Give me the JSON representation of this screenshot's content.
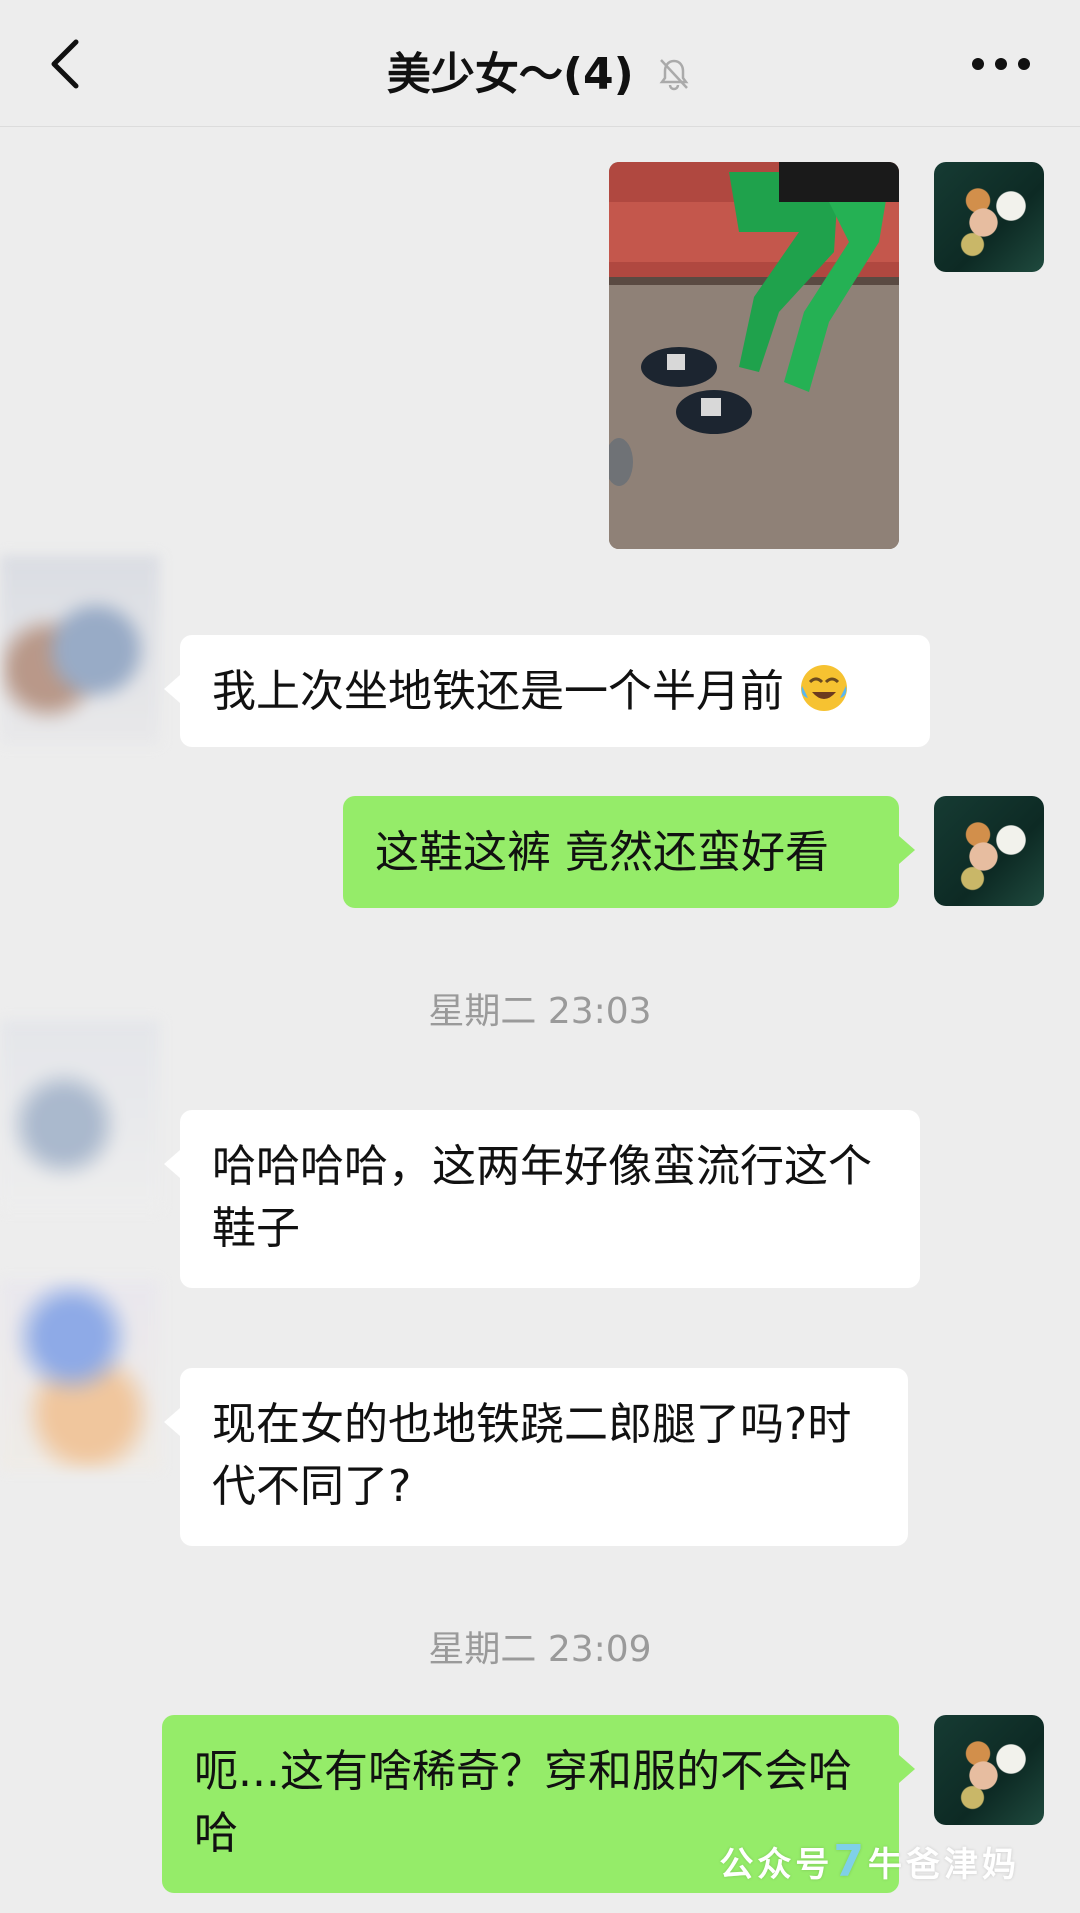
{
  "header": {
    "title": "美少女～(4)",
    "muted": true
  },
  "messages": [
    {
      "type": "image",
      "sender": "me",
      "alt": ""
    },
    {
      "type": "text",
      "sender": "other",
      "text": "我上次坐地铁还是一个半月前",
      "emoji": "face-with-tears"
    },
    {
      "type": "text",
      "sender": "me",
      "text": "这鞋这裤 竟然还蛮好看"
    },
    {
      "type": "time",
      "text": "星期二 23:03"
    },
    {
      "type": "text",
      "sender": "other",
      "text": "哈哈哈哈，这两年好像蛮流行这个鞋子"
    },
    {
      "type": "text",
      "sender": "other",
      "text": "现在女的也地铁跷二郎腿了吗?时代不同了?"
    },
    {
      "type": "time",
      "text": "星期二 23:09"
    },
    {
      "type": "text",
      "sender": "me",
      "text": "呃...这有啥稀奇？穿和服的不会哈哈"
    }
  ],
  "watermark": {
    "prefix": "公众号",
    "seven": "7",
    "suffix": "牛爸津妈"
  },
  "colors": {
    "background": "#ededed",
    "my_bubble": "#95ec69",
    "their_bubble": "#ffffff",
    "time_text": "#9a9a9a"
  }
}
